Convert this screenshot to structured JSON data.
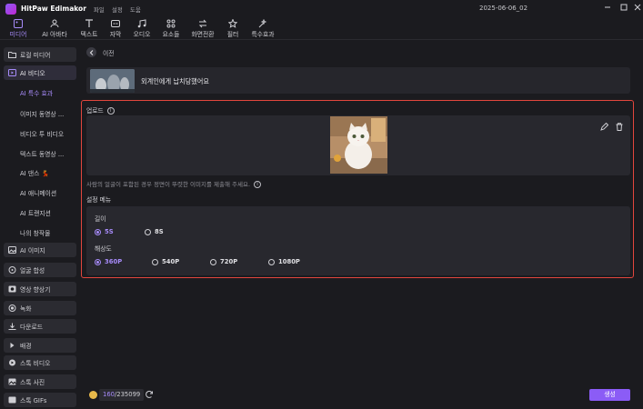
{
  "app": {
    "title": "HitPaw Edimakor",
    "menu": [
      "파일",
      "설정",
      "도움"
    ],
    "project": "2025-06-06_02"
  },
  "toolbar": {
    "items": [
      {
        "label": "미디어",
        "icon": "media-icon"
      },
      {
        "label": "AI 아바타",
        "icon": "avatar-icon"
      },
      {
        "label": "텍스트",
        "icon": "text-icon"
      },
      {
        "label": "자막",
        "icon": "subtitle-icon"
      },
      {
        "label": "오디오",
        "icon": "audio-icon"
      },
      {
        "label": "요소들",
        "icon": "elements-icon"
      },
      {
        "label": "화면전환",
        "icon": "transition-icon"
      },
      {
        "label": "필터",
        "icon": "filter-icon"
      },
      {
        "label": "특수효과",
        "icon": "effects-icon"
      }
    ]
  },
  "sidebar": {
    "local_media": "로컬 미디어",
    "ai_video": "AI 비디오",
    "ai_video_subs": [
      "AI 특수 효과",
      "이미지 동영상 ...",
      "비디오 투 비디오",
      "텍스트 동영상 ...",
      "AI 댄스 💃",
      "AI 애니메이션",
      "AI 트랜지션",
      "나의 창작물"
    ],
    "groups": [
      "AI 이미지",
      "얼굴 합성",
      "영상 향상기",
      "녹화",
      "다운로드",
      "배경",
      "스톡 비디오",
      "스톡 사진",
      "스톡 GIFs"
    ]
  },
  "main": {
    "back_label": "이전",
    "hero_text": "외계인에게 납치당했어요",
    "upload_title": "업로드",
    "tip": "사람의 얼굴이 포함된 경우 정면이 뚜렷한 이미지를 제출해 주세요.",
    "settings_title": "설정 메뉴",
    "length_label": "길이",
    "length_options": [
      "5S",
      "8S"
    ],
    "length_selected": "5S",
    "resolution_label": "해상도",
    "resolution_options": [
      "360P",
      "540P",
      "720P",
      "1080P"
    ],
    "resolution_selected": "360P"
  },
  "footer": {
    "credits_used": "160",
    "credits_total": "/235099",
    "generate_label": "생성"
  }
}
